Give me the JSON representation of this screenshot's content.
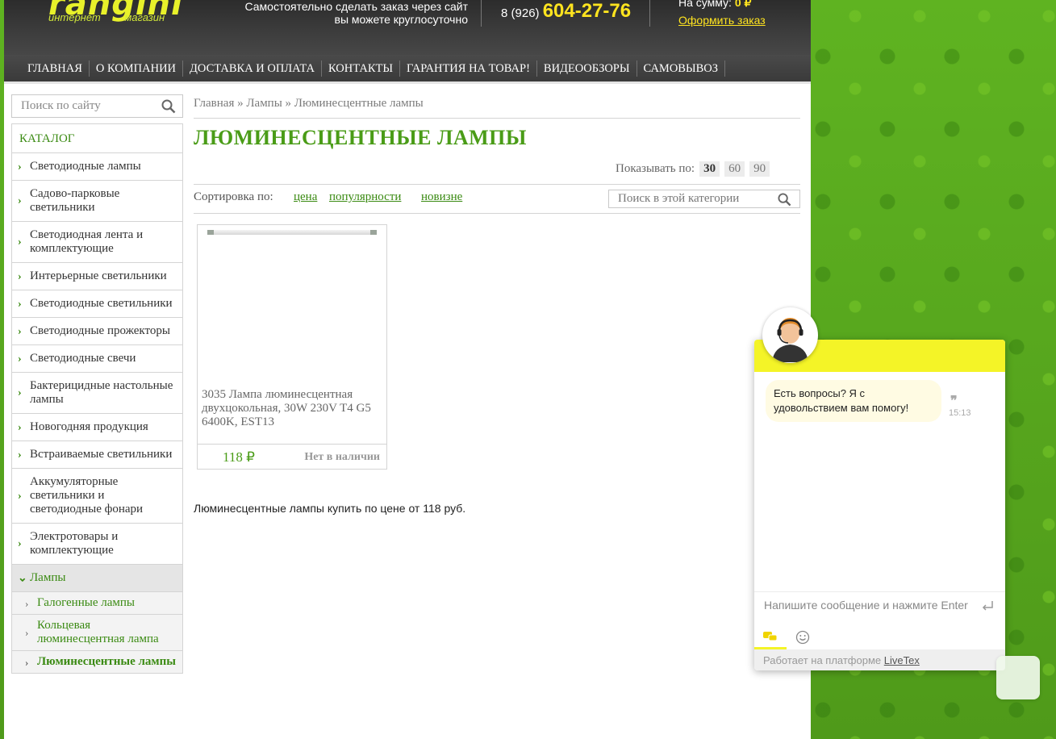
{
  "header": {
    "logo_sub_left": "интернет",
    "logo_sub_right": "магазин",
    "order_text_line1": "Самостоятельно сделать заказ через сайт",
    "order_text_line2": "вы можете круглосуточно",
    "phone_prefix": "8 (926)",
    "phone_number": "604-27-76",
    "cart_label": "На сумму:",
    "cart_sum": "0 ₽",
    "checkout_link": "Оформить заказ"
  },
  "nav": {
    "items": [
      "ГЛАВНАЯ",
      "О КОМПАНИИ",
      "ДОСТАВКА И ОПЛАТА",
      "КОНТАКТЫ",
      "ГАРАНТИЯ НА ТОВАР!",
      "ВИДЕООБЗОРЫ",
      "САМОВЫВОЗ"
    ]
  },
  "search": {
    "placeholder": "Поиск по сайту"
  },
  "catalog": {
    "title": "КАТАЛОГ",
    "items": [
      "Светодиодные лампы",
      "Садово-парковые светильники",
      "Светодиодная лента и комплектующие",
      "Интерьерные светильники",
      "Светодиодные светильники",
      "Светодиодные прожекторы",
      "Светодиодные свечи",
      "Бактерицидные настольные лампы",
      "Новогодняя продукция",
      "Встраиваемые светильники",
      "Аккумуляторные светильники и светодиодные фонари",
      "Электротовары и комплектующие",
      "Лампы"
    ],
    "sub_items": [
      "Галогенные лампы",
      "Кольцевая люминесцентная лампа",
      "Люминесцентные лампы"
    ]
  },
  "breadcrumb": {
    "home": "Главная",
    "sep": "»",
    "lamps": "Лампы",
    "current": "Люминесцентные лампы"
  },
  "page_title": "ЛЮМИНЕСЦЕНТНЫЕ ЛАМПЫ",
  "perpage": {
    "label": "Показывать по:",
    "options": [
      "30",
      "60",
      "90"
    ],
    "selected": "30"
  },
  "sort": {
    "label": "Сортировка по:",
    "options": [
      "цена",
      "популярности",
      "новизне"
    ]
  },
  "category_search": {
    "placeholder": "Поиск в этой категории"
  },
  "products": [
    {
      "title": "3035 Лампа люминесцентная двухцокольная, 30W 230V T4 G5 6400K, EST13",
      "price": "118 ₽",
      "stock": "Нет в наличии"
    }
  ],
  "seo_text": "Люминесцентные лампы купить по цене от 118 руб.",
  "chat": {
    "message": "Есть вопросы? Я с удовольствием вам помогу!",
    "time": "15:13",
    "input_placeholder": "Напишите сообщение и нажмите Enter",
    "footer_text": "Работает на платформе",
    "footer_link": "LiveTex"
  }
}
